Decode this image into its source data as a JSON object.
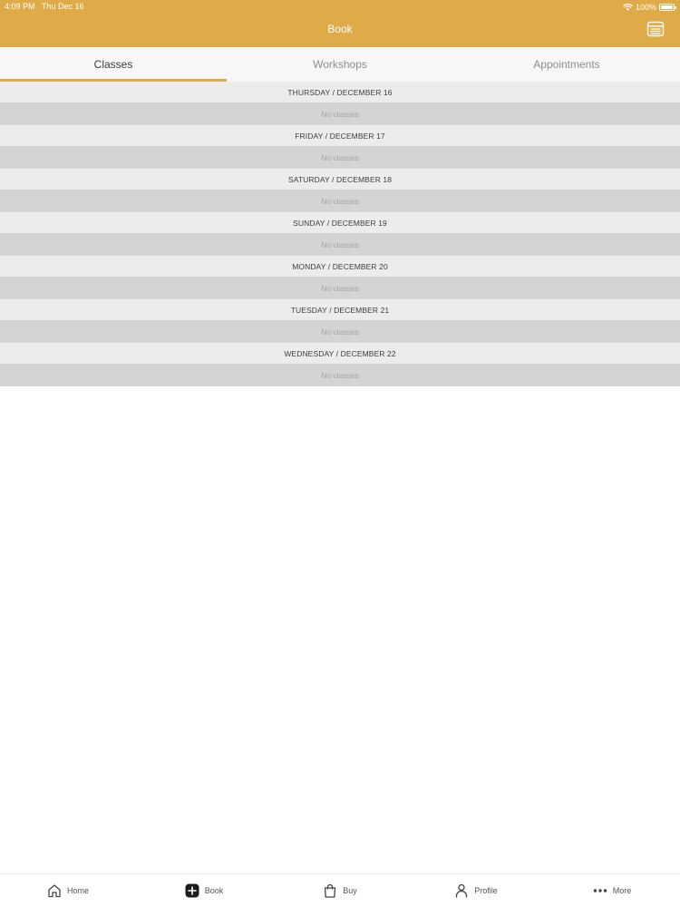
{
  "status_bar": {
    "time": "4:09 PM",
    "date": "Thu Dec 16",
    "battery": "100%"
  },
  "nav": {
    "title": "Book"
  },
  "tabs": [
    {
      "label": "Classes",
      "active": true
    },
    {
      "label": "Workshops",
      "active": false
    },
    {
      "label": "Appointments",
      "active": false
    }
  ],
  "days": [
    {
      "header": "THURSDAY / DECEMBER 16",
      "empty_text": "No classes"
    },
    {
      "header": "FRIDAY / DECEMBER 17",
      "empty_text": "No classes"
    },
    {
      "header": "SATURDAY / DECEMBER 18",
      "empty_text": "No classes"
    },
    {
      "header": "SUNDAY / DECEMBER 19",
      "empty_text": "No classes"
    },
    {
      "header": "MONDAY / DECEMBER 20",
      "empty_text": "No classes"
    },
    {
      "header": "TUESDAY / DECEMBER 21",
      "empty_text": "No classes"
    },
    {
      "header": "WEDNESDAY / DECEMBER 22",
      "empty_text": "No classes"
    }
  ],
  "tabbar": {
    "home": "Home",
    "book": "Book",
    "buy": "Buy",
    "profile": "Profile",
    "more": "More"
  },
  "colors": {
    "accent": "#dfaa48",
    "header_row": "#ececed",
    "empty_row": "#d4d4d7"
  },
  "icons": {
    "calendar": "calendar-icon",
    "home": "home-icon",
    "book": "plus-square-icon",
    "buy": "shopping-bag-icon",
    "profile": "person-icon",
    "more": "ellipsis-icon",
    "wifi": "wifi-icon",
    "battery": "battery-icon"
  }
}
